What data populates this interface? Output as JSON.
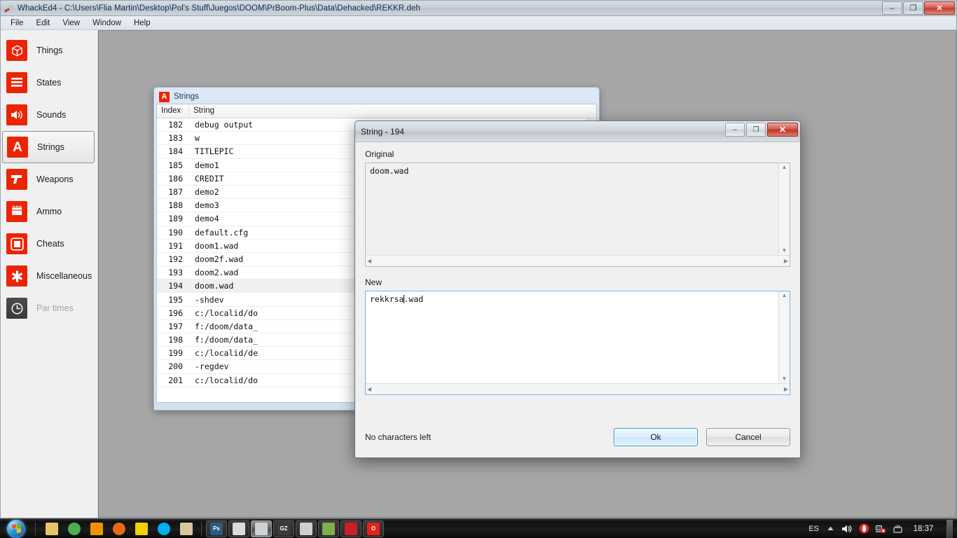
{
  "window": {
    "title": "WhackEd4 - C:\\Users\\Flia Martin\\Desktop\\Pol's Stuff\\Juegos\\DOOM\\PrBoom-Plus\\Data\\Dehacked\\REKKR.deh",
    "icon": "whacked4-icon",
    "minimize_label": "–",
    "maximize_label": "❐",
    "close_label": "✕"
  },
  "menubar": {
    "items": [
      {
        "label": "File"
      },
      {
        "label": "Edit"
      },
      {
        "label": "View"
      },
      {
        "label": "Window"
      },
      {
        "label": "Help"
      }
    ]
  },
  "sidebar": {
    "items": [
      {
        "label": "Things",
        "icon": "cube-icon",
        "selected": false,
        "disabled": false
      },
      {
        "label": "States",
        "icon": "lines-icon",
        "selected": false,
        "disabled": false
      },
      {
        "label": "Sounds",
        "icon": "speaker-icon",
        "selected": false,
        "disabled": false
      },
      {
        "label": "Strings",
        "icon": "letter-a-icon",
        "selected": true,
        "disabled": false
      },
      {
        "label": "Weapons",
        "icon": "pistol-icon",
        "selected": false,
        "disabled": false
      },
      {
        "label": "Ammo",
        "icon": "bullets-icon",
        "selected": false,
        "disabled": false
      },
      {
        "label": "Cheats",
        "icon": "square-icon",
        "selected": false,
        "disabled": false
      },
      {
        "label": "Miscellaneous",
        "icon": "asterisk-icon",
        "selected": false,
        "disabled": false
      },
      {
        "label": "Par times",
        "icon": "clock-icon",
        "selected": false,
        "disabled": true
      }
    ]
  },
  "strings_window": {
    "title": "Strings",
    "icon": "letter-a-icon",
    "columns": {
      "index": "Index",
      "string": "String"
    },
    "rows": [
      {
        "index": "182",
        "string": "debug output",
        "selected": false
      },
      {
        "index": "183",
        "string": "w",
        "selected": false
      },
      {
        "index": "184",
        "string": "TITLEPIC",
        "selected": false
      },
      {
        "index": "185",
        "string": "demo1",
        "selected": false
      },
      {
        "index": "186",
        "string": "CREDIT",
        "selected": false
      },
      {
        "index": "187",
        "string": "demo2",
        "selected": false
      },
      {
        "index": "188",
        "string": "demo3",
        "selected": false
      },
      {
        "index": "189",
        "string": "demo4",
        "selected": false
      },
      {
        "index": "190",
        "string": "default.cfg",
        "selected": false
      },
      {
        "index": "191",
        "string": "doom1.wad",
        "selected": false
      },
      {
        "index": "192",
        "string": "doom2f.wad",
        "selected": false
      },
      {
        "index": "193",
        "string": "doom2.wad",
        "selected": false
      },
      {
        "index": "194",
        "string": "doom.wad",
        "selected": true
      },
      {
        "index": "195",
        "string": "-shdev",
        "selected": false
      },
      {
        "index": "196",
        "string": "c:/localid/do",
        "selected": false
      },
      {
        "index": "197",
        "string": "f:/doom/data_",
        "selected": false
      },
      {
        "index": "198",
        "string": "f:/doom/data_",
        "selected": false
      },
      {
        "index": "199",
        "string": "c:/localid/de",
        "selected": false
      },
      {
        "index": "200",
        "string": "-regdev",
        "selected": false
      },
      {
        "index": "201",
        "string": "c:/localid/do",
        "selected": false
      }
    ]
  },
  "dialog": {
    "title": "String - 194",
    "minimize_label": "–",
    "maximize_label": "❐",
    "close_label": "✕",
    "original": {
      "label": "Original",
      "value": "doom.wad"
    },
    "new": {
      "label": "New",
      "value_before_caret": "rekkrsa",
      "value_after_caret": ".wad"
    },
    "status": "No characters left",
    "ok_label": "Ok",
    "cancel_label": "Cancel"
  },
  "taskbar": {
    "start_label": "start-orb",
    "buttons": [
      {
        "name": "windows-explorer",
        "icon": "folder-icon",
        "color": "#e8c36a",
        "state": "quick"
      },
      {
        "name": "google-chrome",
        "icon": "chrome-icon",
        "color": "#4caf50",
        "state": "quick"
      },
      {
        "name": "media-player",
        "icon": "play-icon",
        "color": "#f29100",
        "state": "quick"
      },
      {
        "name": "firefox",
        "icon": "firefox-icon",
        "color": "#e86a12",
        "state": "quick"
      },
      {
        "name": "slade",
        "icon": "slade-icon",
        "color": "#f2d200",
        "state": "quick"
      },
      {
        "name": "skype",
        "icon": "skype-icon",
        "color": "#00aff0",
        "state": "quick"
      },
      {
        "name": "paint-tool",
        "icon": "palette-icon",
        "color": "#d8c8a0",
        "state": "quick"
      },
      {
        "name": "photoshop",
        "icon": "ps-icon",
        "color": "#2b5b84",
        "label": "Ps",
        "state": "task"
      },
      {
        "name": "gzdoom-builder",
        "icon": "builder-icon",
        "color": "#dcdcdc",
        "state": "task"
      },
      {
        "name": "whacked4",
        "icon": "whacked4-icon",
        "color": "#d0d0d0",
        "state": "active"
      },
      {
        "name": "gzdoom",
        "icon": "gz-icon",
        "color": "#3b3b3b",
        "label": "GZ",
        "state": "task"
      },
      {
        "name": "doom-game",
        "icon": "skull-icon",
        "color": "#cfcfcf",
        "state": "task"
      },
      {
        "name": "image-viewer",
        "icon": "picture-icon",
        "color": "#7fae4e",
        "state": "task"
      },
      {
        "name": "adobe-reader",
        "icon": "pdf-icon",
        "color": "#c8202a",
        "state": "task"
      },
      {
        "name": "opera",
        "icon": "opera-icon",
        "color": "#e2231a",
        "label": "O",
        "state": "task"
      }
    ],
    "tray": {
      "language": "ES",
      "show_hidden": "show-hidden-icons",
      "volume": "volume-icon",
      "opera_tray": "opera-icon",
      "network": "network-error-icon",
      "action_center": "action-center-icon",
      "clock": "18:37"
    }
  }
}
